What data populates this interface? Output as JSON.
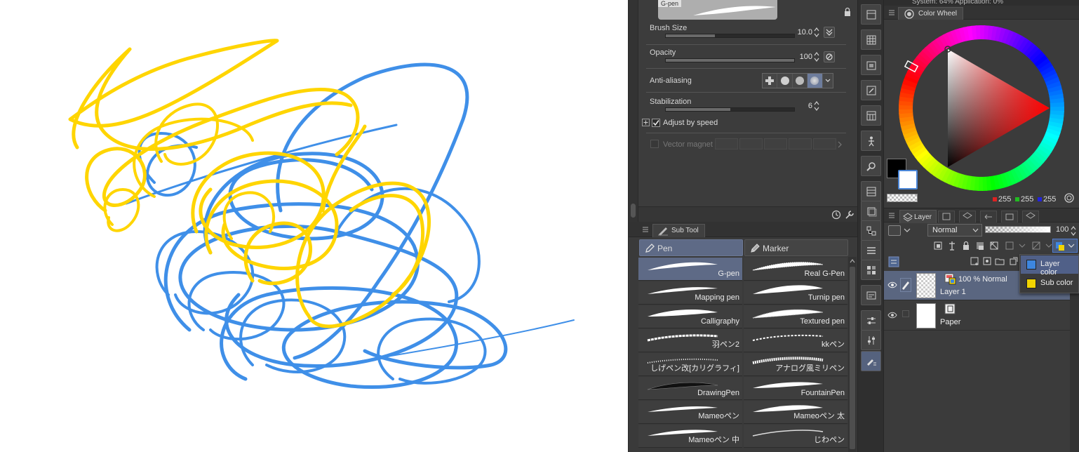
{
  "tool_property": {
    "sub_tool_tab": "G-pen",
    "brush_size": {
      "label": "Brush Size",
      "value": "10.0",
      "fill": 0.38
    },
    "opacity": {
      "label": "Opacity",
      "value": "100",
      "fill": 1.0
    },
    "anti_aliasing": {
      "label": "Anti-aliasing",
      "selected_index": 3
    },
    "stabilization": {
      "label": "Stabilization",
      "value": "6",
      "fill": 0.5
    },
    "adjust_by_speed": {
      "label": "Adjust by speed",
      "checked": true
    },
    "vector_magnet": {
      "label": "Vector magnet",
      "checked": false
    }
  },
  "sub_tool": {
    "title": "Sub Tool",
    "groups": [
      {
        "label": "Pen",
        "selected": true
      },
      {
        "label": "Marker",
        "selected": false
      }
    ],
    "brushes": [
      {
        "name": "G-pen",
        "selected": true
      },
      {
        "name": "Real G-Pen",
        "selected": false
      },
      {
        "name": "Mapping pen",
        "selected": false
      },
      {
        "name": "Turnip pen",
        "selected": false
      },
      {
        "name": "Calligraphy",
        "selected": false
      },
      {
        "name": "Textured pen",
        "selected": false
      },
      {
        "name": "羽ペン2",
        "selected": false
      },
      {
        "name": "kkペン",
        "selected": false
      },
      {
        "name": "しげペン改[カリグラフィ]",
        "selected": false
      },
      {
        "name": "アナログ風ミリペン",
        "selected": false
      },
      {
        "name": "DrawingPen",
        "selected": false
      },
      {
        "name": "FountainPen",
        "selected": false
      },
      {
        "name": "Mameoペン",
        "selected": false
      },
      {
        "name": "Mameoペン 太",
        "selected": false
      },
      {
        "name": "Mameoペン 中",
        "selected": false
      },
      {
        "name": "じわペン",
        "selected": false
      }
    ]
  },
  "color_wheel": {
    "top_text": "System: 64%  Application: 0%",
    "title": "Color Wheel",
    "main_color": "#000000",
    "sub_color": "#ffffff",
    "rgb": {
      "r": "255",
      "g": "255",
      "b": "255"
    }
  },
  "layer": {
    "title": "Layer",
    "blend_mode": "Normal",
    "opacity": "100",
    "layers": [
      {
        "name": "Layer 1",
        "mode": "100 % Normal",
        "selected": true
      },
      {
        "name": "Paper",
        "mode": "",
        "selected": false
      }
    ],
    "layer_color_menu": [
      {
        "label": "Layer color",
        "color": "#3d86e0",
        "selected": true
      },
      {
        "label": "Sub color",
        "color": "#f2d400",
        "selected": false
      }
    ]
  },
  "canvas": {
    "stroke_colors": {
      "blue": "#3f8fe8",
      "yellow": "#ffd500"
    }
  }
}
